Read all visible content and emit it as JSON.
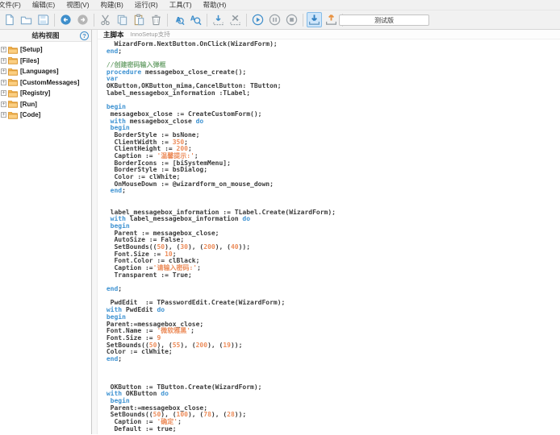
{
  "menubar": {
    "items": [
      "文件(F)",
      "编辑(E)",
      "视图(V)",
      "构建(B)",
      "运行(R)",
      "工具(T)",
      "帮助(H)"
    ]
  },
  "toolbar": {
    "icon_names": [
      "new-file",
      "open-folder",
      "save",
      "back",
      "forward",
      "cut",
      "copy",
      "paste",
      "delete",
      "find",
      "replace",
      "save-close-down",
      "save-close-x",
      "run",
      "pause",
      "stop",
      "compile",
      "export",
      "help"
    ],
    "test_version_button": "测试版"
  },
  "sidebar": {
    "title": "结构视图",
    "items": [
      "[Setup]",
      "[Files]",
      "[Languages]",
      "[CustomMessages]",
      "[Registry]",
      "[Run]",
      "[Code]"
    ]
  },
  "editor": {
    "tab_primary": "主脚本",
    "tab_secondary": "InnoSetup支持",
    "code_lines": [
      [
        [
          "t",
          "   WizardForm.NextButton.OnClick(WizardForm);"
        ]
      ],
      [
        [
          "t",
          " "
        ],
        [
          "k",
          "end"
        ],
        [
          "t",
          ";"
        ]
      ],
      [],
      [
        [
          "t",
          " "
        ],
        [
          "c",
          "//创建密码输入弹框"
        ]
      ],
      [
        [
          "t",
          " "
        ],
        [
          "k",
          "procedure"
        ],
        [
          "t",
          " messagebox_close_create();"
        ]
      ],
      [
        [
          "t",
          " "
        ],
        [
          "k",
          "var"
        ]
      ],
      [
        [
          "t",
          " OKButton,OKButton_mima,CancelButton: TButton;"
        ]
      ],
      [
        [
          "t",
          " label_messagebox_information :TLabel;"
        ]
      ],
      [],
      [
        [
          "t",
          " "
        ],
        [
          "k",
          "begin"
        ]
      ],
      [
        [
          "t",
          "  messagebox_close := CreateCustomForm();"
        ]
      ],
      [
        [
          "t",
          "  "
        ],
        [
          "k",
          "with"
        ],
        [
          "t",
          " messagebox_close "
        ],
        [
          "k",
          "do"
        ]
      ],
      [
        [
          "t",
          "  "
        ],
        [
          "k",
          "begin"
        ]
      ],
      [
        [
          "t",
          "   BorderStyle := bsNone;"
        ]
      ],
      [
        [
          "t",
          "   ClientWidth := "
        ],
        [
          "n",
          "350"
        ],
        [
          "t",
          ";"
        ]
      ],
      [
        [
          "t",
          "   ClientHeight := "
        ],
        [
          "n",
          "200"
        ],
        [
          "t",
          ";"
        ]
      ],
      [
        [
          "t",
          "   Caption := "
        ],
        [
          "s",
          "'温馨提示:'"
        ],
        [
          "t",
          ";"
        ]
      ],
      [
        [
          "t",
          "   BorderIcons := [biSystemMenu];"
        ]
      ],
      [
        [
          "t",
          "   BorderStyle := bsDialog;"
        ]
      ],
      [
        [
          "t",
          "   Color := clWhite;"
        ]
      ],
      [
        [
          "t",
          "   OnMouseDown := @wizardform_on_mouse_down;"
        ]
      ],
      [
        [
          "t",
          "  "
        ],
        [
          "k",
          "end"
        ],
        [
          "t",
          ";"
        ]
      ],
      [],
      [],
      [
        [
          "t",
          "  label_messagebox_information := TLabel.Create(WizardForm);"
        ]
      ],
      [
        [
          "t",
          "  "
        ],
        [
          "k",
          "with"
        ],
        [
          "t",
          " label_messagebox_information "
        ],
        [
          "k",
          "do"
        ]
      ],
      [
        [
          "t",
          "  "
        ],
        [
          "k",
          "begin"
        ]
      ],
      [
        [
          "t",
          "   Parent := messagebox_close;"
        ]
      ],
      [
        [
          "t",
          "   AutoSize := False;"
        ]
      ],
      [
        [
          "t",
          "   SetBounds(("
        ],
        [
          "n",
          "50"
        ],
        [
          "t",
          "), ("
        ],
        [
          "n",
          "30"
        ],
        [
          "t",
          "), ("
        ],
        [
          "n",
          "200"
        ],
        [
          "t",
          "), ("
        ],
        [
          "n",
          "40"
        ],
        [
          "t",
          "));"
        ]
      ],
      [
        [
          "t",
          "   Font.Size := "
        ],
        [
          "n",
          "10"
        ],
        [
          "t",
          ";"
        ]
      ],
      [
        [
          "t",
          "   Font.Color := clBlack;"
        ]
      ],
      [
        [
          "t",
          "   Caption :="
        ],
        [
          "s",
          "'请输入密码:'"
        ],
        [
          "t",
          ";"
        ]
      ],
      [
        [
          "t",
          "   Transparent := True;"
        ]
      ],
      [],
      [
        [
          "t",
          " "
        ],
        [
          "k",
          "end"
        ],
        [
          "t",
          ";"
        ]
      ],
      [],
      [
        [
          "t",
          "  PwdEdit  := TPasswordEdit.Create(WizardForm);"
        ]
      ],
      [
        [
          "t",
          " "
        ],
        [
          "k",
          "with"
        ],
        [
          "t",
          " PwdEdit "
        ],
        [
          "k",
          "do"
        ]
      ],
      [
        [
          "t",
          " "
        ],
        [
          "k",
          "begin"
        ]
      ],
      [
        [
          "t",
          " Parent:=messagebox_close;"
        ]
      ],
      [
        [
          "t",
          " Font.Name := "
        ],
        [
          "s",
          "'微软雅黑'"
        ],
        [
          "t",
          ";"
        ]
      ],
      [
        [
          "t",
          " Font.Size := "
        ],
        [
          "n",
          "9"
        ]
      ],
      [
        [
          "t",
          " SetBounds(("
        ],
        [
          "n",
          "50"
        ],
        [
          "t",
          "), ("
        ],
        [
          "n",
          "55"
        ],
        [
          "t",
          "), ("
        ],
        [
          "n",
          "200"
        ],
        [
          "t",
          "), ("
        ],
        [
          "n",
          "19"
        ],
        [
          "t",
          "));"
        ]
      ],
      [
        [
          "t",
          " Color := clWhite;"
        ]
      ],
      [
        [
          "t",
          " "
        ],
        [
          "k",
          "end"
        ],
        [
          "t",
          ";"
        ]
      ],
      [],
      [],
      [],
      [
        [
          "t",
          "  OKButton := TButton.Create(WizardForm);"
        ]
      ],
      [
        [
          "t",
          " "
        ],
        [
          "k",
          "with"
        ],
        [
          "t",
          " OKButton "
        ],
        [
          "k",
          "do"
        ]
      ],
      [
        [
          "t",
          "  "
        ],
        [
          "k",
          "begin"
        ]
      ],
      [
        [
          "t",
          "  Parent:=messagebox_close;"
        ]
      ],
      [
        [
          "t",
          "  SetBounds(("
        ],
        [
          "n",
          "50"
        ],
        [
          "t",
          "), ("
        ],
        [
          "n",
          "100"
        ],
        [
          "t",
          "), ("
        ],
        [
          "n",
          "78"
        ],
        [
          "t",
          "), ("
        ],
        [
          "n",
          "28"
        ],
        [
          "t",
          "));"
        ]
      ],
      [
        [
          "t",
          "   Caption := "
        ],
        [
          "s",
          "'确定'"
        ],
        [
          "t",
          ";"
        ]
      ],
      [
        [
          "t",
          "   Default := true;"
        ]
      ]
    ]
  },
  "colors": {
    "accent_blue": "#3e8ecb",
    "icon_gray": "#8f989e",
    "icon_orange": "#e8913f",
    "folder_orange": "#f5a93c",
    "keyword": "#3f93d2",
    "string_number": "#ec8c5a",
    "comment": "#76a876",
    "chrome_bg": "#f1f1f1"
  }
}
